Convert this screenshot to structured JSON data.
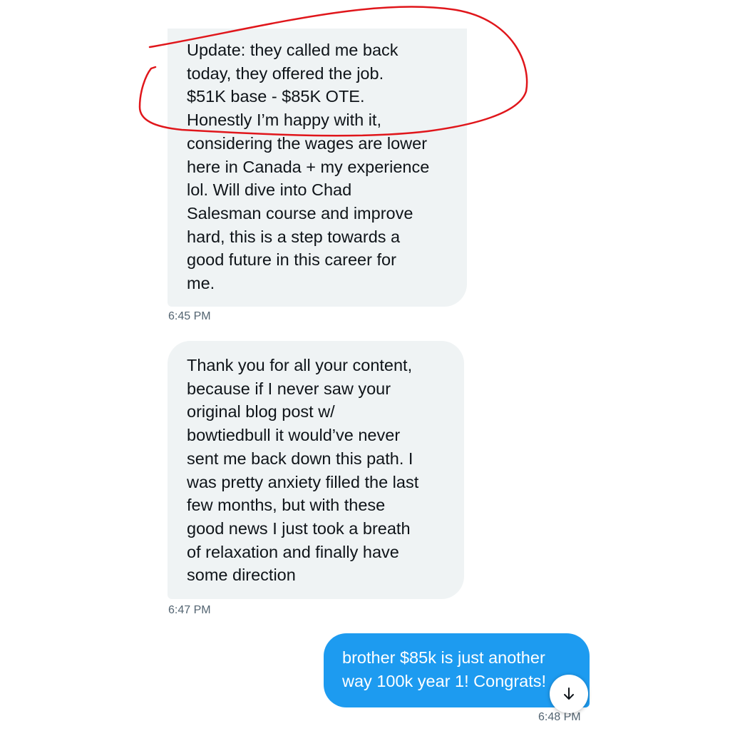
{
  "conversation": {
    "messages": [
      {
        "direction": "incoming",
        "text": "Update: they called me back\ntoday, they offered the job.\n$51K base - $85K OTE.\nHonestly I’m happy with it,\nconsidering the wages are lower\nhere in Canada + my experience\nlol. Will dive into Chad\nSalesman course and improve\nhard, this is a step towards a\ngood future in this career for\nme.",
        "time": "6:45 PM"
      },
      {
        "direction": "incoming",
        "text": "Thank you for all your content,\nbecause if I never saw your\noriginal blog post w/\nbowtiedbull it would’ve never\nsent me back down this path. I\nwas pretty anxiety filled the last\nfew months, but with these\ngood news I just took a breath\nof relaxation and finally have\nsome direction",
        "time": "6:47 PM"
      },
      {
        "direction": "outgoing",
        "text": "brother $85k is just another\nway 100k year 1! Congrats!",
        "time": "6:48 PM"
      }
    ]
  },
  "scroll_button": {
    "icon": "arrow-down-icon"
  },
  "annotation": {
    "type": "hand-drawn circle",
    "color": "#e0161b"
  },
  "colors": {
    "incoming_bubble": "#eff3f4",
    "outgoing_bubble": "#1d9bf0",
    "timestamp": "#536471"
  }
}
